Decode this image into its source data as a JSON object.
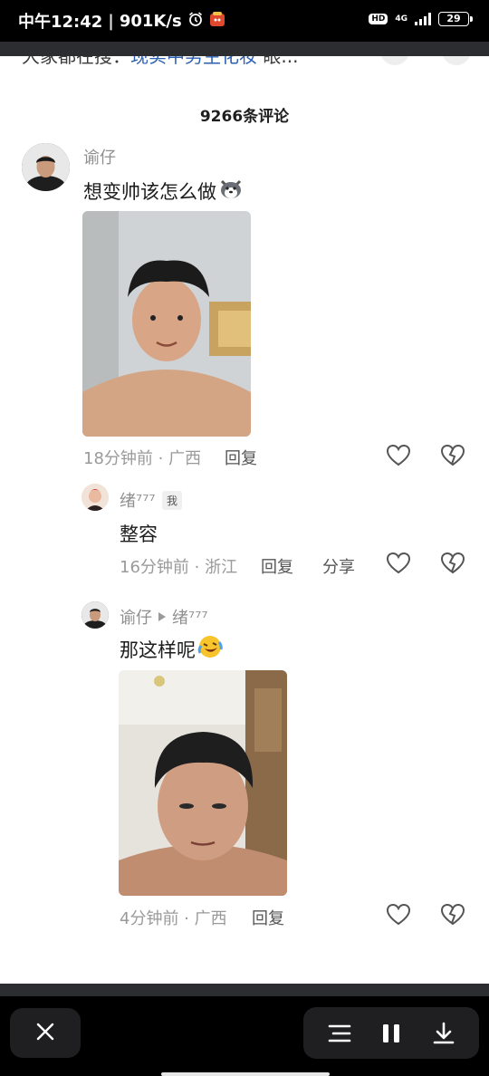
{
  "status_bar": {
    "time": "中午12:42",
    "separator": "|",
    "speed": "901K/s",
    "hd": "HD",
    "network": "4G",
    "battery": "29"
  },
  "header": {
    "peek_prefix": "大家都在搜：",
    "peek_link": "现实中男生化妆",
    "peek_suffix": " 眼...",
    "comment_count": "9266条评论"
  },
  "comments": [
    {
      "user": "谕仔",
      "text": "想变帅该怎么做",
      "emoji": "husky-emoji",
      "time_location": "18分钟前 · 广西",
      "reply_label": "回复"
    }
  ],
  "replies": [
    {
      "user": "绪⁷⁷⁷",
      "me_tag": "我",
      "text": "整容",
      "time_location": "16分钟前 · 浙江",
      "reply_label": "回复",
      "share_label": "分享"
    },
    {
      "user": "谕仔",
      "reply_to": "绪⁷⁷⁷",
      "text": "那这样呢",
      "emoji": "laughing-crying-emoji",
      "time_location": "4分钟前 · 广西",
      "reply_label": "回复"
    }
  ],
  "icons": {
    "like": "heart-icon",
    "dislike": "broken-heart-icon",
    "close": "close-icon",
    "menu": "menu-icon",
    "pause": "pause-icon",
    "download": "download-icon"
  },
  "colors": {
    "link": "#2b5fb3",
    "meta": "#9a9a9a",
    "text": "#1c1c1c"
  }
}
